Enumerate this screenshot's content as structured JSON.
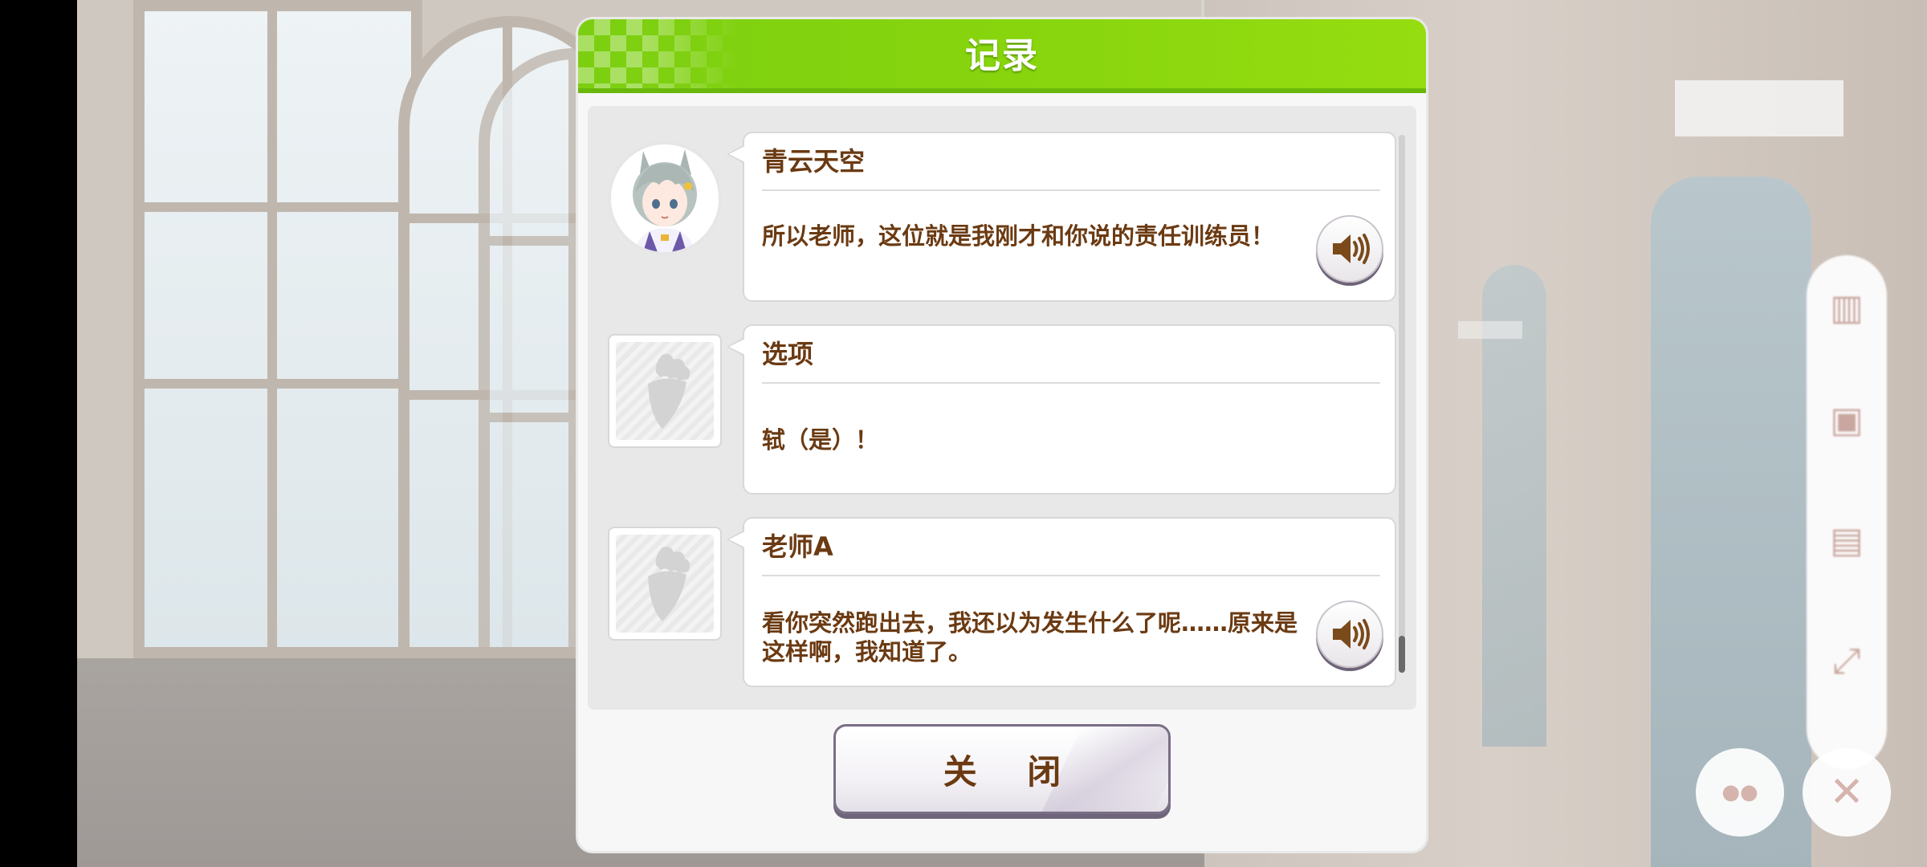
{
  "dialog": {
    "title": "记录",
    "close_label": "关 闭"
  },
  "entries": [
    {
      "speaker": "青云天空",
      "text": "所以老师，这位就是我刚才和你说的责任训练员！",
      "portrait": "character-avatar",
      "has_voice": true
    },
    {
      "speaker": "选项",
      "text": "轼（是）！",
      "portrait": "blank-carrot",
      "has_voice": false
    },
    {
      "speaker": "老师A",
      "text": "看你突然跑出去，我还以为发生什么了呢……原来是这样啊，我知道了。",
      "portrait": "blank-carrot",
      "has_voice": true
    }
  ],
  "icons": {
    "voice": "speaker-volume-icon",
    "placeholder_portrait": "carrot-silhouette-icon"
  },
  "colors": {
    "header_green": "#8ad60e",
    "text_brown": "#6b3a12",
    "button_shadow": "#6f657b"
  }
}
